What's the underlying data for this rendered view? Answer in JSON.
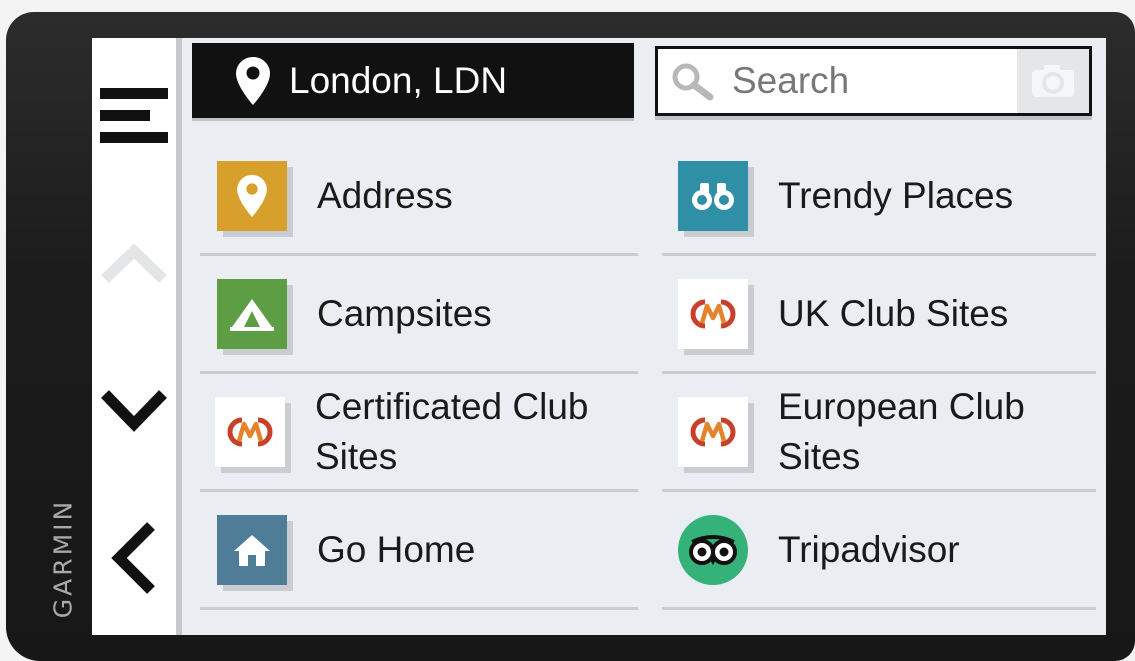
{
  "brand": "GARMIN",
  "header": {
    "location": "London, LDN",
    "search_placeholder": "Search"
  },
  "rail": {
    "menu_icon": "hamburger-menu-icon",
    "up_icon": "chevron-up-icon",
    "down_icon": "chevron-down-icon",
    "back_icon": "back-arrow-icon"
  },
  "categories": [
    {
      "label": "Address",
      "icon": "location-pin-icon",
      "color": "#d7a02c"
    },
    {
      "label": "Trendy Places",
      "icon": "binoculars-icon",
      "color": "#2e8fa6"
    },
    {
      "label": "Campsites",
      "icon": "tent-icon",
      "color": "#5d9e45"
    },
    {
      "label": "UK Club Sites",
      "icon": "club-logo-icon",
      "color": "#ffffff"
    },
    {
      "label": "Certificated Club Sites",
      "icon": "club-logo-icon",
      "color": "#ffffff"
    },
    {
      "label": "European Club Sites",
      "icon": "club-logo-icon",
      "color": "#ffffff"
    },
    {
      "label": "Go Home",
      "icon": "home-icon",
      "color": "#4f7c96"
    },
    {
      "label": "Tripadvisor",
      "icon": "tripadvisor-owl-icon",
      "color": "#34b27a"
    }
  ]
}
